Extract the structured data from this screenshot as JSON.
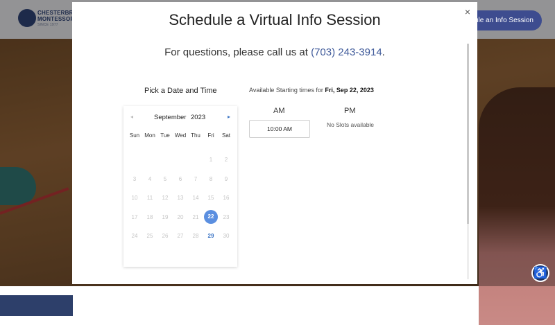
{
  "site": {
    "brand_line1": "CHESTERBROOK",
    "brand_line2": "MONTESSORI",
    "brand_since": "SINCE 1977",
    "header_cta": "dule an Info Session"
  },
  "modal": {
    "title": "Schedule a Virtual Info Session",
    "phone_prefix": "For questions, please call us at ",
    "phone": "(703) 243-3914",
    "phone_suffix": ".",
    "close_icon": "×"
  },
  "calendar": {
    "heading": "Pick a Date and Time",
    "prev_icon": "◂",
    "next_icon": "▸",
    "month": "September",
    "year": "2023",
    "weekdays": [
      "Sun",
      "Mon",
      "Tue",
      "Wed",
      "Thu",
      "Fri",
      "Sat"
    ],
    "weeks": [
      [
        "",
        "",
        "",
        "",
        "",
        "1",
        "2"
      ],
      [
        "3",
        "4",
        "5",
        "6",
        "7",
        "8",
        "9"
      ],
      [
        "10",
        "11",
        "12",
        "13",
        "14",
        "15",
        "16"
      ],
      [
        "17",
        "18",
        "19",
        "20",
        "21",
        "22",
        "23"
      ],
      [
        "24",
        "25",
        "26",
        "27",
        "28",
        "29",
        "30"
      ]
    ],
    "selected_day": "22",
    "available_days": [
      "29"
    ]
  },
  "times": {
    "label": "Available Starting times for ",
    "date": "Fri, Sep 22, 2023",
    "am_label": "AM",
    "pm_label": "PM",
    "am_slots": [
      "10:00 AM"
    ],
    "pm_empty": "No Slots available"
  },
  "accessibility_icon": "accessibility-icon"
}
